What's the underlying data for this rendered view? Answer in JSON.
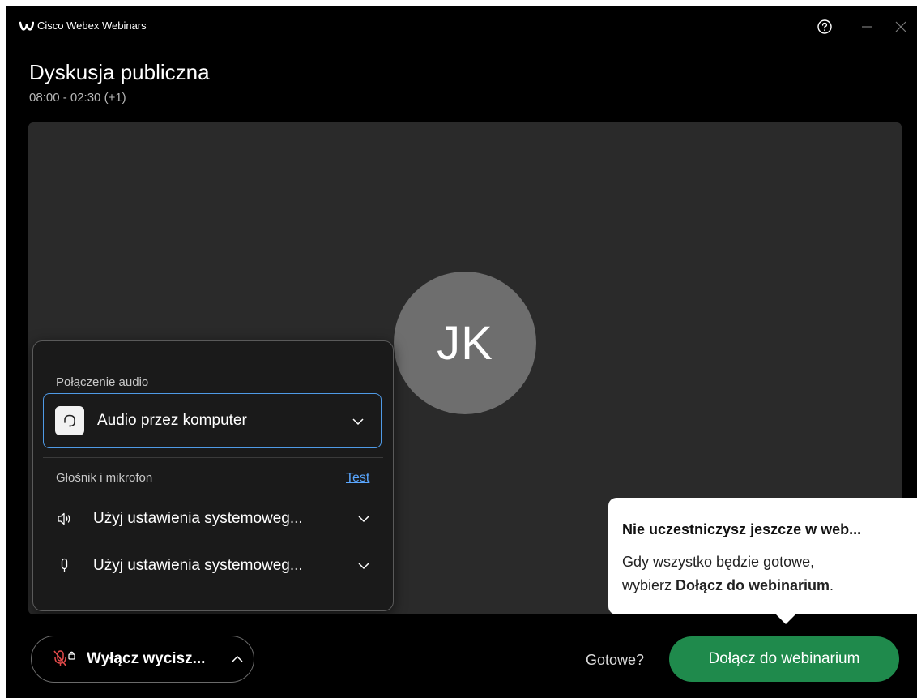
{
  "app": {
    "title": "Cisco Webex Webinars"
  },
  "header": {
    "title": "Dyskusja publiczna",
    "time": "08:00 - 02:30 (+1)"
  },
  "preview": {
    "avatar_initials": "JK"
  },
  "audio_panel": {
    "connection_label": "Połączenie audio",
    "connection_value": "Audio przez komputer",
    "speaker_mic_label": "Głośnik i mikrofon",
    "test_label": "Test",
    "speaker_value": "Użyj ustawienia systemoweg...",
    "microphone_value": "Użyj ustawienia systemoweg..."
  },
  "tooltip": {
    "title": "Nie uczestniczysz jeszcze w web...",
    "line1": "Gdy wszystko będzie gotowe,",
    "line2_prefix": "wybierz ",
    "line2_bold": "Dołącz do webinarium",
    "line2_suffix": "."
  },
  "bottom_bar": {
    "unmute_label": "Wyłącz wycisz...",
    "ready_label": "Gotowe?",
    "join_label": "Dołącz do webinarium"
  },
  "colors": {
    "join_button": "#1f8a4c",
    "focus_border": "#4f9ae6",
    "link": "#5aa7ff",
    "muted_icon": "#e34b4b"
  }
}
